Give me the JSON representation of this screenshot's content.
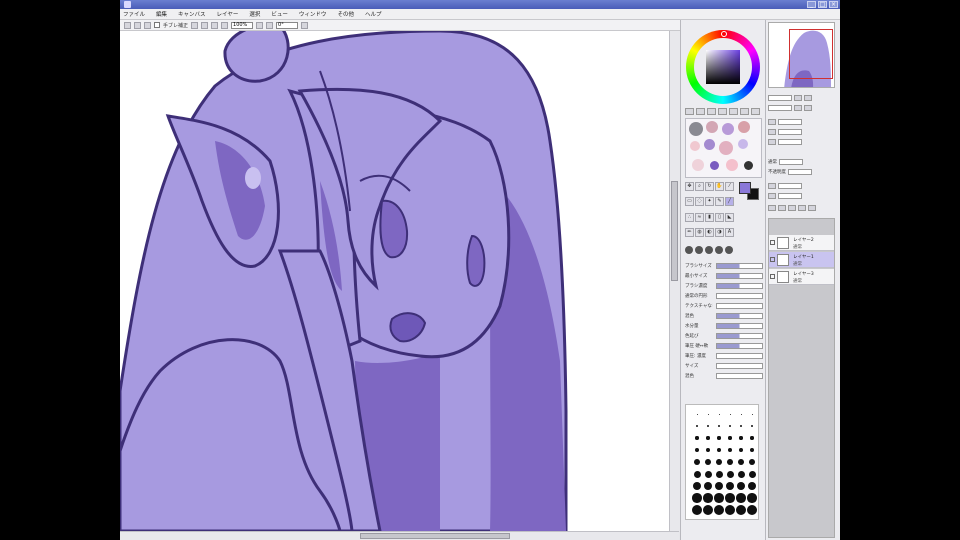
{
  "window": {
    "title": "",
    "controls": [
      "_",
      "□",
      "×"
    ]
  },
  "menu": {
    "items": [
      "ファイル",
      "編集",
      "キャンバス",
      "レイヤー",
      "選択",
      "ビュー",
      "ウィンドウ",
      "その他",
      "ヘルプ"
    ]
  },
  "toolbar": {
    "stabilizer_label": "手ブレ補正",
    "zoom_value": "100%",
    "angle_value": "0°"
  },
  "color": {
    "fg": "#8a78d8",
    "bg": "#111111",
    "accent": "#6a3fe0"
  },
  "colors": {
    "skin": "#a79ae0",
    "shadow": "#7e67c2",
    "line": "#3e2f78",
    "mouth": "#6e58b8"
  },
  "tool_props": {
    "rows": [
      "ブラシサイズ",
      "最小サイズ",
      "ブラシ濃度",
      "通常の円形",
      "テクスチャなし",
      "混色",
      "水分量",
      "色延び",
      "筆圧 硬↔軟",
      "筆圧: 濃度",
      "サイズ",
      "混色"
    ]
  },
  "layers": {
    "opacity_label": "不透明度",
    "blend_label": "通常",
    "items": [
      {
        "name": "レイヤー2",
        "mode": "通常",
        "selected": false
      },
      {
        "name": "レイヤー1",
        "mode": "通常",
        "selected": true
      },
      {
        "name": "レイヤー3",
        "mode": "通常",
        "selected": false
      }
    ]
  }
}
